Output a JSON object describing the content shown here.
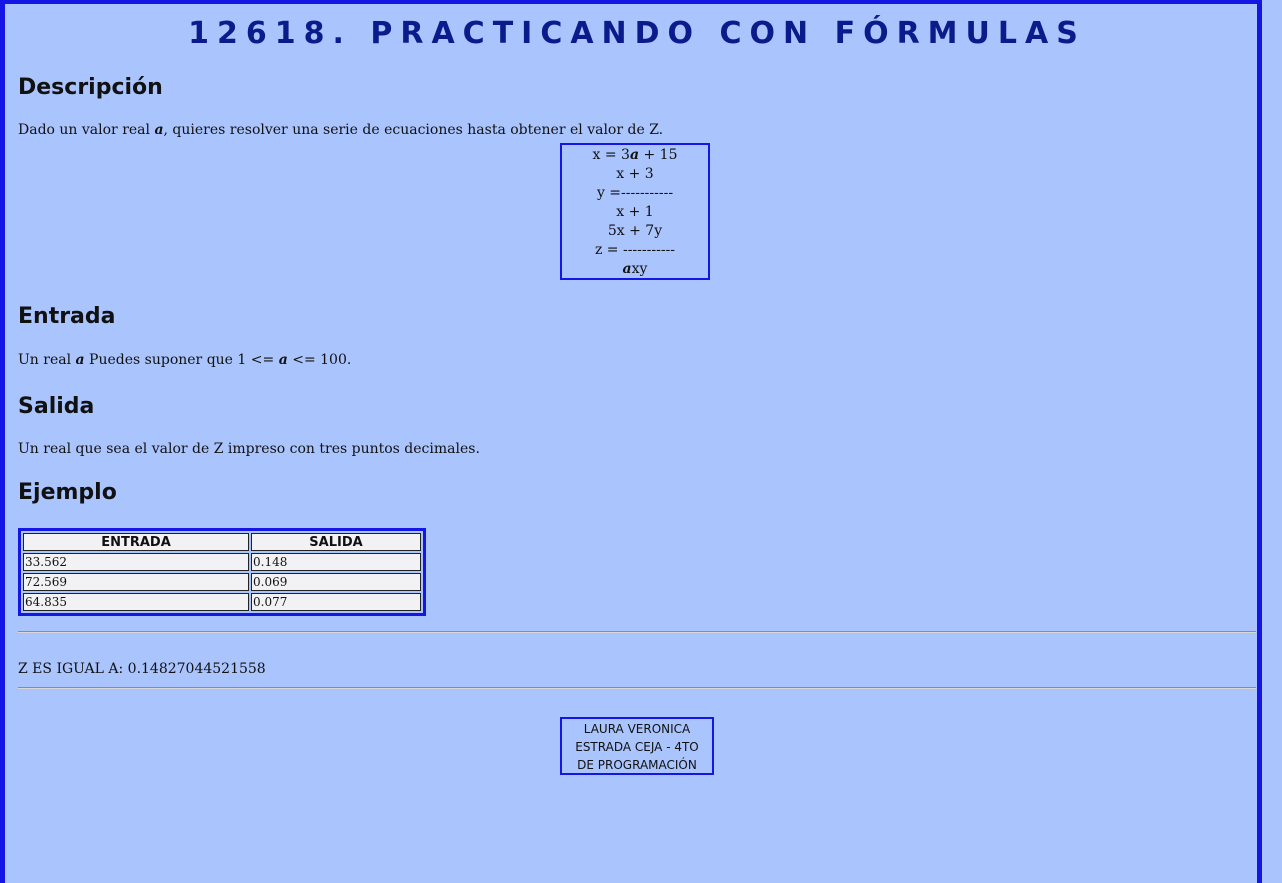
{
  "title": "12618. PRACTICANDO CON FÓRMULAS",
  "sections": {
    "descripcion": {
      "heading": "Descripción",
      "text_before": "Dado un valor real ",
      "var": "a",
      "text_after": ", quieres resolver una serie de ecuaciones hasta obtener el valor de Z."
    },
    "entrada": {
      "heading": "Entrada",
      "text_1": "Un real ",
      "var_1": "a",
      "text_2": " Puedes suponer que 1 <= ",
      "var_2": "a",
      "text_3": " <= 100."
    },
    "salida": {
      "heading": "Salida",
      "text": "Un real que sea el valor de Z impreso con tres puntos decimales."
    },
    "ejemplo": {
      "heading": "Ejemplo"
    }
  },
  "formula": {
    "line1_a": "x = 3",
    "line1_var": "a",
    "line1_b": " + 15",
    "line2": "x + 3",
    "line3": "y =-----------",
    "line4": "x + 1",
    "line5": "5x + 7y",
    "line6": "z = -----------",
    "line7_var": "a",
    "line7_b": "xy"
  },
  "example_table": {
    "headers": [
      "ENTRADA",
      "SALIDA"
    ],
    "rows": [
      [
        "33.562",
        "0.148"
      ],
      [
        "72.569",
        "0.069"
      ],
      [
        "64.835",
        "0.077"
      ]
    ]
  },
  "result": "Z ES IGUAL A: 0.14827044521558",
  "footer": {
    "line1": "LAURA VERONICA",
    "line2": "ESTRADA CEJA - 4TO",
    "line3": "DE PROGRAMACIÓN"
  },
  "colors": {
    "background": "#aac4fd",
    "border_accent": "#1515e6",
    "title": "#0c1b8c"
  }
}
